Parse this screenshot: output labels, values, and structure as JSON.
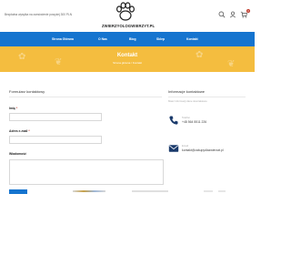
{
  "header": {
    "shipping_text": "Bezpłatna wysyłka na zamówienie powyżej 300 PLN",
    "logo_text": "ZWIERZYOLOGWIERZYT.PL",
    "cart_count": "0"
  },
  "nav": {
    "items": [
      {
        "label": "Strona Główna"
      },
      {
        "label": "O Nas"
      },
      {
        "label": "Blog"
      },
      {
        "label": "Sklep"
      },
      {
        "label": "Kontakt"
      }
    ]
  },
  "banner": {
    "title": "Kontakt",
    "breadcrumb": "Strona główna  /  Kontakt"
  },
  "form": {
    "title": "Formularz kontaktowy",
    "name_label": "Imię",
    "email_label": "Adres e-mail",
    "message_label": "Wiadomość",
    "required_mark": "*"
  },
  "info": {
    "title": "Informacje kontaktowe",
    "subtitle": "Masz informacji dane skontaktowe",
    "phone_label": "Telefon",
    "phone_value": "+48 564 5511 226",
    "email_label": "Email",
    "email_value": "kontakt@zakupydlazwierzat.pl"
  },
  "colors": {
    "nav_blue": "#1574cf",
    "banner_yellow": "#f4bd3f",
    "required_red": "#c0392b"
  }
}
